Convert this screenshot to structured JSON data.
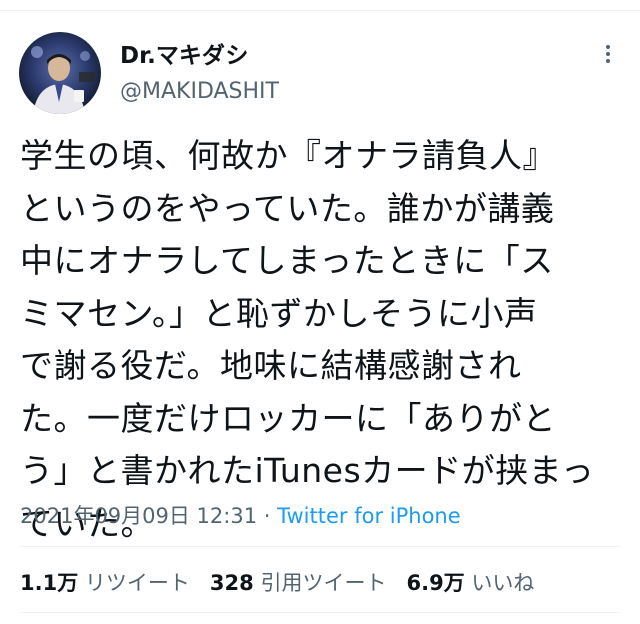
{
  "user": {
    "display_name": "Dr.マキダシ",
    "handle": "@MAKIDASHIT"
  },
  "tweet": {
    "lines": [
      "学生の頃、何故か『オナラ請負人』",
      "というのをやっていた。誰かが講義",
      "中にオナラしてしまったときに「ス",
      "ミマセン。」と恥ずかしそうに小声",
      "で謝る役だ。地味に結構感謝され",
      "た。一度だけロッカーに「ありがと",
      "う」と書かれたiTunesカードが挟まっ",
      "ていた。"
    ]
  },
  "meta": {
    "timestamp": "2021年09月09日 12:31",
    "separator": "·",
    "source": "Twitter for iPhone"
  },
  "stats": {
    "retweets": {
      "count": "1.1万",
      "label": "リツイート"
    },
    "quotes": {
      "count": "328",
      "label": "引用ツイート"
    },
    "likes": {
      "count": "6.9万",
      "label": "いいね"
    }
  },
  "icons": {
    "more": "more-dots-vertical-icon"
  },
  "colors": {
    "text_primary": "#0f1419",
    "text_secondary": "#536471",
    "link": "#1d9bf0",
    "divider": "#eff3f4"
  }
}
